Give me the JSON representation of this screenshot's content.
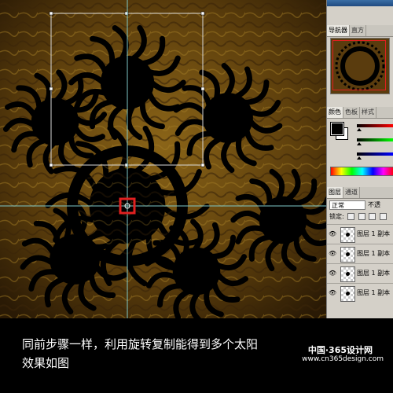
{
  "canvas": {
    "colors": {
      "base": "#7a5414",
      "shadow": "#2a1a05",
      "guide": "#7ec8c8",
      "selection": "#d8d8d8",
      "anchor": "#e02020"
    }
  },
  "panels": {
    "navigator": {
      "tabs": [
        "导航器",
        "直方"
      ]
    },
    "color": {
      "tabs": [
        "颜色",
        "色板",
        "样式"
      ]
    },
    "layers": {
      "tabs": [
        "图层",
        "通道"
      ],
      "blend_mode": "正常",
      "opacity_label": "不透",
      "lock_label": "锁定:",
      "rows": [
        {
          "name": "图层 1 副本"
        },
        {
          "name": "图层 1 副本"
        },
        {
          "name": "图层 1 副本"
        },
        {
          "name": "图层 1 副本"
        }
      ]
    }
  },
  "caption": {
    "line1": "同前步骤一样，利用旋转复制能得到多个太阳",
    "line2": "效果如图"
  },
  "watermark": {
    "line1": "中国·365设计网",
    "line2": "www.cn365design.com"
  },
  "icons": [
    "eye-icon",
    "layer-thumbnail-icon",
    "lock-icon",
    "move-icon",
    "brush-icon"
  ]
}
